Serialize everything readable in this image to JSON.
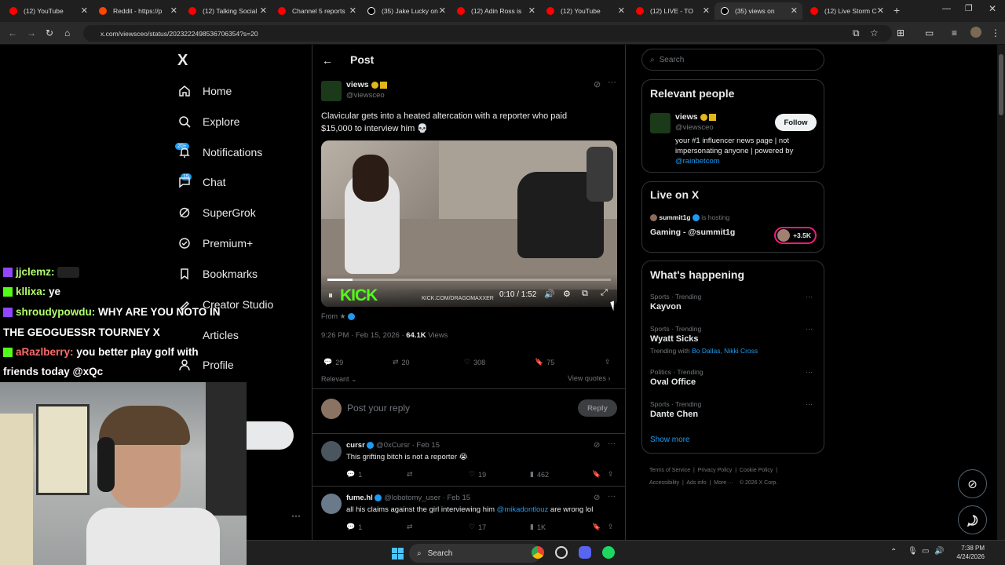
{
  "browser": {
    "tabs": [
      {
        "label": "(12) YouTube",
        "color": "#ff0000"
      },
      {
        "label": "Reddit - https://p",
        "color": "#ff4500"
      },
      {
        "label": "(12) Talking Social",
        "color": "#ff0000"
      },
      {
        "label": "Channel 5 reports",
        "color": "#ff0000"
      },
      {
        "label": "(35) Jake Lucky on",
        "color": "#ffffff"
      },
      {
        "label": "(12) Adin Ross is",
        "color": "#ff0000"
      },
      {
        "label": "(12) YouTube",
        "color": "#ff0000"
      },
      {
        "label": "(12) LIVE - TO",
        "color": "#ff0000"
      },
      {
        "label": "(35) views on",
        "color": "#ffffff"
      },
      {
        "label": "(12) Live Storm C",
        "color": "#ff0000"
      }
    ],
    "url": "x.com/viewsceo/status/2023222498536706354?s=20"
  },
  "nav": {
    "logo": "X",
    "items": [
      {
        "label": "Home",
        "icon": "home-icon"
      },
      {
        "label": "Explore",
        "icon": "search-icon"
      },
      {
        "label": "Notifications",
        "icon": "bell-icon"
      },
      {
        "label": "Chat",
        "icon": "chat-icon"
      },
      {
        "label": "SuperGrok",
        "icon": "grok-icon"
      },
      {
        "label": "Premium+",
        "icon": "premium-icon"
      },
      {
        "label": "Bookmarks",
        "icon": "bookmark-icon"
      },
      {
        "label": "Creator Studio",
        "icon": "creator-icon"
      },
      {
        "label": "Articles",
        "icon": "articles-icon"
      },
      {
        "label": "Profile",
        "icon": "profile-icon"
      }
    ],
    "notif_badge": "20+",
    "chat_badge": "15"
  },
  "chat_overlay": [
    {
      "user": "jjclemz:",
      "msg": "",
      "color": "#b0ff6a"
    },
    {
      "user": "kllixa:",
      "msg": "ye",
      "color": "#b0ff6a"
    },
    {
      "user": "shroudypowdu:",
      "msg": "WHY ARE YOU NOTO IN",
      "color": "#b0ff6a"
    },
    {
      "user": "",
      "msg": "THE GEOGUESSR TOURNEY X",
      "color": "#ffffff"
    },
    {
      "user": "aRazlberry:",
      "msg": "you better play golf with",
      "color": "#ff6a6a"
    },
    {
      "user": "",
      "msg": "friends today @xQc",
      "color": "#ffffff"
    }
  ],
  "post": {
    "header_title": "Post",
    "author_name": "views",
    "author_handle": "@viewsceo",
    "text": "Clavicular gets into a heated altercation with a reporter who paid $15,000 to interview him 💀",
    "video": {
      "time": "0:10 / 1:52",
      "watermark": "KICK",
      "channel": "KICK.COM/DRAGOMAXXER",
      "progress": 0.09
    },
    "from_label": "From",
    "timestamp": "9:26 PM · Feb 15, 2026 · ",
    "views_count": "64.1K",
    "views_label": "Views",
    "stats": {
      "replies": "29",
      "reposts": "20",
      "likes": "308",
      "bookmarks": "75"
    },
    "sort_label": "Relevant",
    "view_quotes": "View quotes",
    "reply_placeholder": "Post your reply",
    "reply_button": "Reply"
  },
  "replies": [
    {
      "name": "cursr",
      "handle": "@0xCursr",
      "date": "· Feb 15",
      "text": "This grifting bitch is not a reporter 😭",
      "replies": "1",
      "likes": "19",
      "views": "462"
    },
    {
      "name": "fume.hl",
      "handle": "@lobotomy_user",
      "date": "· Feb 15",
      "text_before": "all his claims against the girl interviewing him ",
      "mention": "@mikadontlouz",
      "text_after": " are wrong lol",
      "replies": "1",
      "likes": "17",
      "views": "1K"
    }
  ],
  "right": {
    "search_placeholder": "Search",
    "relevant_title": "Relevant people",
    "person": {
      "name": "views",
      "handle": "@viewsceo",
      "bio": "your #1 influencer news page | not impersonating anyone | powered by ",
      "bio_link": "@rainbetcom",
      "follow": "Follow"
    },
    "live_title": "Live on X",
    "live_host": "summit1g",
    "live_hosting": "is hosting",
    "live_stream": "Gaming - @summit1g",
    "live_count": "+3.5K",
    "happening_title": "What's happening",
    "trends": [
      {
        "cat": "Sports · Trending",
        "name": "Kayvon",
        "extra": ""
      },
      {
        "cat": "Sports · Trending",
        "name": "Wyatt Sicks",
        "extra_prefix": "Trending with ",
        "extra": "Bo Dallas, Nikki Cross"
      },
      {
        "cat": "Politics · Trending",
        "name": "Oval Office",
        "extra": ""
      },
      {
        "cat": "Sports · Trending",
        "name": "Dante Chen",
        "extra": ""
      }
    ],
    "show_more": "Show more",
    "footer": [
      "Terms of Service",
      "Privacy Policy",
      "Cookie Policy",
      "Accessibility",
      "Ads info",
      "More ···",
      "© 2026 X Corp."
    ]
  },
  "taskbar": {
    "search": "Search",
    "time": "7:38 PM",
    "date": "4/24/2026"
  }
}
